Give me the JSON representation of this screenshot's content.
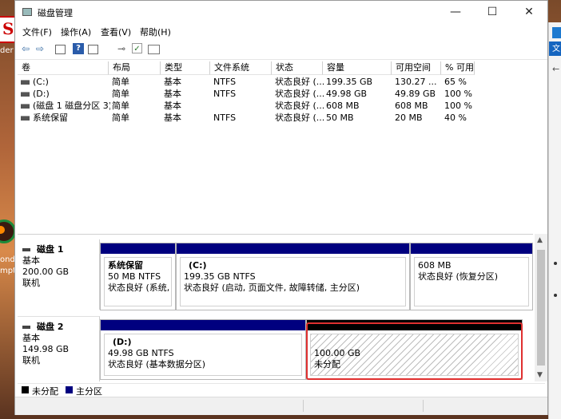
{
  "window": {
    "title": "磁盘管理"
  },
  "controls": {
    "minimize": "—",
    "maximize": "☐",
    "close": "✕"
  },
  "menu": [
    "文件(F)",
    "操作(A)",
    "查看(V)",
    "帮助(H)"
  ],
  "desktop": {
    "logo_char": "S",
    "frag_lines": [
      "der",
      "ond",
      "mpt"
    ],
    "right_tab_char": "文"
  },
  "table": {
    "headers": [
      "卷",
      "布局",
      "类型",
      "文件系统",
      "状态",
      "容量",
      "可用空间",
      "% 可用"
    ],
    "rows": [
      [
        "(C:)",
        "简单",
        "基本",
        "NTFS",
        "状态良好 (...",
        "199.35 GB",
        "130.27 ...",
        "65 %"
      ],
      [
        "(D:)",
        "简单",
        "基本",
        "NTFS",
        "状态良好 (...",
        "49.98 GB",
        "49.89 GB",
        "100 %"
      ],
      [
        "(磁盘 1 磁盘分区 3)",
        "简单",
        "基本",
        "",
        "状态良好 (...",
        "608 MB",
        "608 MB",
        "100 %"
      ],
      [
        "系统保留",
        "简单",
        "基本",
        "NTFS",
        "状态良好 (...",
        "50 MB",
        "20 MB",
        "40 %"
      ]
    ]
  },
  "disks": [
    {
      "name": "磁盘 1",
      "kind": "基本",
      "size": "200.00 GB",
      "state": "联机",
      "partitions": [
        {
          "name": "系统保留",
          "detail": "50 MB NTFS",
          "status": "状态良好 (系统, 活",
          "type": "primary"
        },
        {
          "name": "(C:)",
          "detail": "199.35 GB NTFS",
          "status": "状态良好 (启动, 页面文件, 故障转储, 主分区)",
          "type": "primary"
        },
        {
          "name": "",
          "detail": "608 MB",
          "status": "状态良好 (恢复分区)",
          "type": "primary"
        }
      ]
    },
    {
      "name": "磁盘 2",
      "kind": "基本",
      "size": "149.98 GB",
      "state": "联机",
      "partitions": [
        {
          "name": "(D:)",
          "detail": "49.98 GB NTFS",
          "status": "状态良好 (基本数据分区)",
          "type": "primary"
        },
        {
          "name": "",
          "detail": "100.00 GB",
          "status": "未分配",
          "type": "unallocated"
        }
      ]
    }
  ],
  "legend": [
    {
      "label": "未分配",
      "color": "#000000"
    },
    {
      "label": "主分区",
      "color": "#00007f"
    }
  ],
  "colors": {
    "primary": "#00007f",
    "unallocated": "#000000",
    "highlight": "#e03030"
  }
}
